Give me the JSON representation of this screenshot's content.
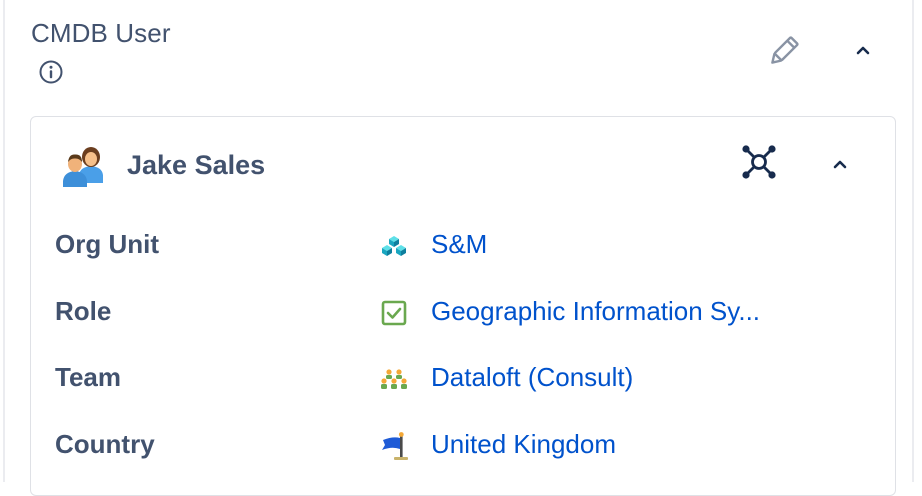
{
  "panel": {
    "title": "CMDB User",
    "info_icon": "info-circle-icon",
    "edit_icon": "pencil-icon",
    "collapse_icon": "chevron-up-icon"
  },
  "user_card": {
    "name": "Jake Sales",
    "avatar_icon": "people-icon",
    "graph_icon": "relationship-graph-icon",
    "collapse_icon": "chevron-up-icon",
    "attributes": [
      {
        "label": "Org Unit",
        "value": "S&M",
        "icon": "cubes-icon"
      },
      {
        "label": "Role",
        "value": "Geographic Information Sy...",
        "icon": "checkbox-icon"
      },
      {
        "label": "Team",
        "value": "Dataloft (Consult)",
        "icon": "team-icon"
      },
      {
        "label": "Country",
        "value": "United Kingdom",
        "icon": "flag-icon"
      }
    ]
  },
  "colors": {
    "text": "#42526e",
    "link": "#0052cc",
    "border": "#dfe1e6"
  }
}
